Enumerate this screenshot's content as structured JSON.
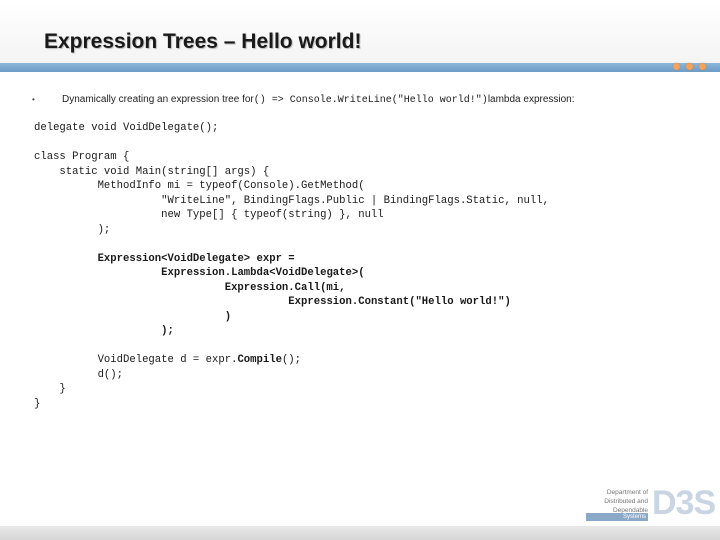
{
  "slide": {
    "title": "Expression Trees – Hello world!"
  },
  "bullet": {
    "marker": "•",
    "text_before": "Dynamically creating an expression tree for ",
    "code": "() => Console.WriteLine(\"Hello world!\")",
    "text_after": " lambda expression:"
  },
  "code_lines": [
    {
      "parts": [
        {
          "t": "delegate void VoidDelegate();"
        }
      ]
    },
    {
      "parts": [
        {
          "t": ""
        }
      ]
    },
    {
      "parts": [
        {
          "t": "class Program {"
        }
      ]
    },
    {
      "parts": [
        {
          "t": "    static void Main(string[] args) {"
        }
      ]
    },
    {
      "parts": [
        {
          "t": "          MethodInfo mi = typeof(Console).GetMethod("
        }
      ]
    },
    {
      "parts": [
        {
          "t": "                    \"WriteLine\", BindingFlags.Public | BindingFlags.Static, null,"
        }
      ]
    },
    {
      "parts": [
        {
          "t": "                    new Type[] { typeof(string) }, null"
        }
      ]
    },
    {
      "parts": [
        {
          "t": "          );"
        }
      ]
    },
    {
      "parts": [
        {
          "t": ""
        }
      ]
    },
    {
      "parts": [
        {
          "t": "          ",
          "b": false
        },
        {
          "t": "Expression<VoidDelegate> expr =",
          "b": true
        }
      ]
    },
    {
      "parts": [
        {
          "t": "                    ",
          "b": false
        },
        {
          "t": "Expression.Lambda<VoidDelegate>(",
          "b": true
        }
      ]
    },
    {
      "parts": [
        {
          "t": "                              ",
          "b": false
        },
        {
          "t": "Expression.Call(mi,",
          "b": true
        }
      ]
    },
    {
      "parts": [
        {
          "t": "                                        ",
          "b": false
        },
        {
          "t": "Expression.Constant(\"Hello world!\")",
          "b": true
        }
      ]
    },
    {
      "parts": [
        {
          "t": "                              ",
          "b": false
        },
        {
          "t": ")",
          "b": true
        }
      ]
    },
    {
      "parts": [
        {
          "t": "                    ",
          "b": false
        },
        {
          "t": ");",
          "b": true
        }
      ]
    },
    {
      "parts": [
        {
          "t": ""
        }
      ]
    },
    {
      "parts": [
        {
          "t": "          VoidDelegate d = expr."
        },
        {
          "t": "Compile",
          "b": true
        },
        {
          "t": "();"
        }
      ]
    },
    {
      "parts": [
        {
          "t": "          d();"
        }
      ]
    },
    {
      "parts": [
        {
          "t": "    }"
        }
      ]
    },
    {
      "parts": [
        {
          "t": "}"
        }
      ]
    }
  ],
  "logo": {
    "line1": "Department of",
    "line2": "Distributed and",
    "line3": "Dependable",
    "line4": "Systems",
    "mark": "D3S"
  },
  "colors": {
    "title_rule": "#7aa7cf",
    "dots": "#f5a35a"
  }
}
